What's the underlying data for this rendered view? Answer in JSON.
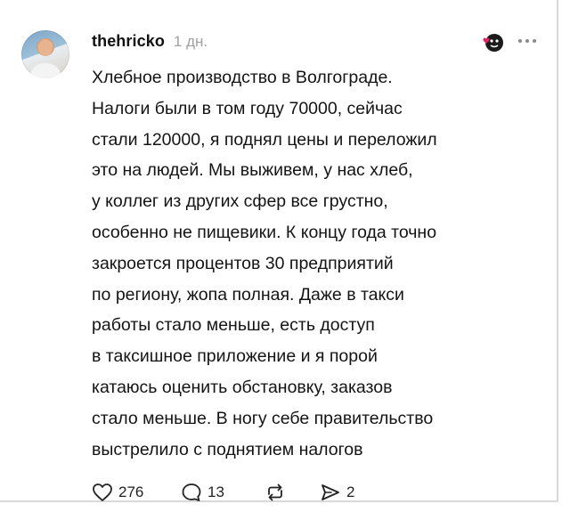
{
  "post": {
    "username": "thehricko",
    "timestamp": "1 дн.",
    "lines": [
      "Хлебное производство в Волгограде.",
      "Налоги были в том году 70000, сейчас",
      "стали 120000, я поднял цены и переложил",
      "это на людей. Мы выживем, у нас хлеб,",
      "у коллег из других сфер все грустно,",
      "особенно не пищевики. К концу года точно",
      "закроется процентов 30 предприятий",
      "по региону, жопа полная. Даже в такси",
      "работы стало меньше, есть доступ",
      "в таксишное приложение и я порой",
      "катаюсь оценить обстановку, заказов",
      "стало меньше. В ногу себе правительство",
      "выстрелило с поднятием налогов"
    ]
  },
  "actions": {
    "likes": "276",
    "comments": "13",
    "shares": "2"
  },
  "icons": {
    "avatar": "avatar",
    "emoji": "face-emoji-icon",
    "more": "more-icon",
    "like": "heart-icon",
    "comment": "comment-icon",
    "repost": "repost-icon",
    "share": "send-icon"
  },
  "colors": {
    "text": "#141414",
    "muted": "#a0a0a0",
    "background": "#ffffff"
  }
}
